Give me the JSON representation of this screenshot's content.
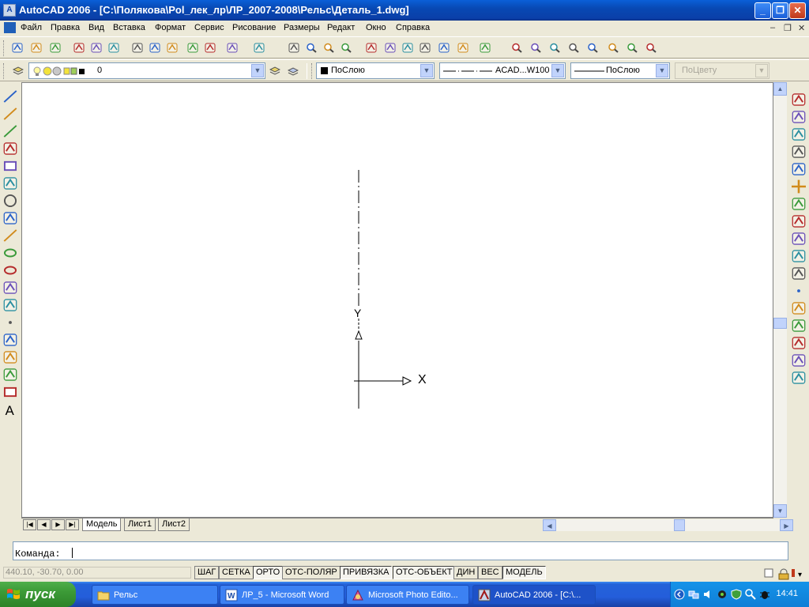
{
  "window": {
    "title": "AutoCAD 2006 - [C:\\Полякова\\Pol_лек_лр\\ЛР_2007-2008\\Рельс\\Деталь_1.dwg]",
    "minimize": "_",
    "restore": "❐",
    "close": "✕"
  },
  "menu": {
    "items": [
      "Файл",
      "Правка",
      "Вид",
      "Вставка",
      "Формат",
      "Сервис",
      "Рисование",
      "Размеры",
      "Редакт",
      "Окно",
      "Справка"
    ],
    "doc_minimize": "–",
    "doc_restore": "❐",
    "doc_close": "✕"
  },
  "layers": {
    "current_layer": "0",
    "color": "ПоСлою",
    "linetype": "ACAD...W100",
    "lineweight": "ПоСлою",
    "plotstyle": "ПоЦвету"
  },
  "canvas": {
    "ucs_x_label": "X",
    "ucs_y_label": "Y"
  },
  "layout_tabs": {
    "items": [
      "Модель",
      "Лист1",
      "Лист2"
    ],
    "active": "Модель"
  },
  "command": {
    "prompt": "Команда:"
  },
  "status": {
    "coords": "440.10, -30.70, 0.00",
    "buttons": [
      "ШАГ",
      "СЕТКА",
      "ОРТО",
      "ОТС-ПОЛЯР",
      "ПРИВЯЗКА",
      "ОТС-ОБЪЕКТ",
      "ДИН",
      "ВЕС",
      "МОДЕЛЬ"
    ],
    "pressed": [
      "ОРТО",
      "ПРИВЯЗКА",
      "ОТС-ОБЪЕКТ",
      "МОДЕЛЬ"
    ]
  },
  "taskbar": {
    "start_label": "пуск",
    "tasks": [
      {
        "label": "Рельс"
      },
      {
        "label": "ЛР_5 - Microsoft Word"
      },
      {
        "label": "Microsoft Photo Edito..."
      },
      {
        "label": "AutoCAD 2006 - [C:\\..."
      }
    ],
    "active_task": 3,
    "time": "14:41"
  },
  "icons": {
    "tb1": [
      "new-icon",
      "open-icon",
      "save-icon",
      "plot-icon",
      "plot-preview-icon",
      "publish-icon",
      "cut-icon",
      "copy-icon",
      "paste-icon",
      "match-properties-icon",
      "block-editor-icon",
      "undo-icon",
      "redo-icon",
      "pan-icon",
      "zoom-realtime-icon",
      "zoom-window-icon",
      "zoom-previous-icon",
      "properties-icon",
      "design-center-icon",
      "tool-palettes-icon",
      "sheet-set-icon",
      "markup-icon",
      "calculator-icon",
      "help-icon",
      "zoom-in-icon",
      "zoom-out-icon",
      "zoom-extents-icon",
      "zoom-all-icon",
      "zoom-scale-icon",
      "zoom-center-icon",
      "zoom-dynamic-icon",
      "zoom-object-icon"
    ],
    "draw": [
      "line-icon",
      "construction-line-icon",
      "polyline-icon",
      "polygon-icon",
      "rectangle-icon",
      "arc-icon",
      "circle-icon",
      "revision-cloud-icon",
      "spline-icon",
      "ellipse-icon",
      "ellipse-arc-icon",
      "insert-block-icon",
      "make-block-icon",
      "point-icon",
      "hatch-icon",
      "gradient-icon",
      "region-icon",
      "table-icon",
      "multiline-text-icon"
    ],
    "modify": [
      "erase-icon",
      "copy-object-icon",
      "mirror-icon",
      "offset-icon",
      "array-icon",
      "move-icon",
      "rotate-icon",
      "scale-icon",
      "stretch-icon",
      "trim-icon",
      "extend-icon",
      "break-at-point-icon",
      "break-icon",
      "join-icon",
      "chamfer-icon",
      "fillet-icon",
      "explode-icon"
    ]
  }
}
